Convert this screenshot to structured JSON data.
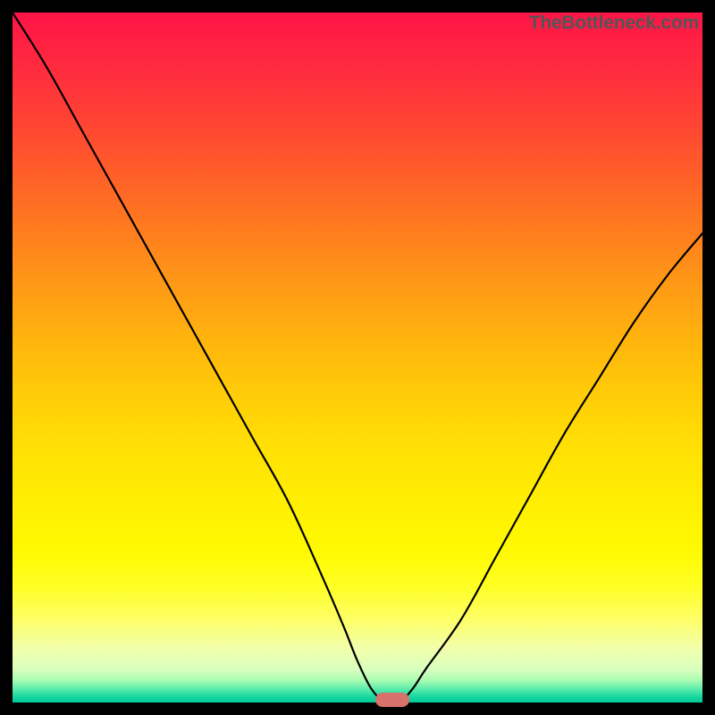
{
  "attribution": "TheBottleneck.com",
  "colors": {
    "frame": "#000000",
    "curve": "#000000",
    "marker": "#d6716b"
  },
  "chart_data": {
    "type": "line",
    "title": "",
    "xlabel": "",
    "ylabel": "",
    "xlim": [
      0,
      100
    ],
    "ylim": [
      0,
      100
    ],
    "x": [
      0,
      5,
      10,
      15,
      20,
      25,
      30,
      35,
      40,
      45,
      48,
      50,
      52,
      54,
      56,
      58,
      60,
      65,
      70,
      75,
      80,
      85,
      90,
      95,
      100
    ],
    "y": [
      100,
      92,
      83,
      74,
      65,
      56,
      47,
      38,
      29,
      18,
      11,
      6,
      2,
      0,
      0,
      2,
      5,
      12,
      21,
      30,
      39,
      47,
      55,
      62,
      68
    ],
    "marker": {
      "x": 55,
      "y": 0
    },
    "grid": false,
    "legend": false
  }
}
